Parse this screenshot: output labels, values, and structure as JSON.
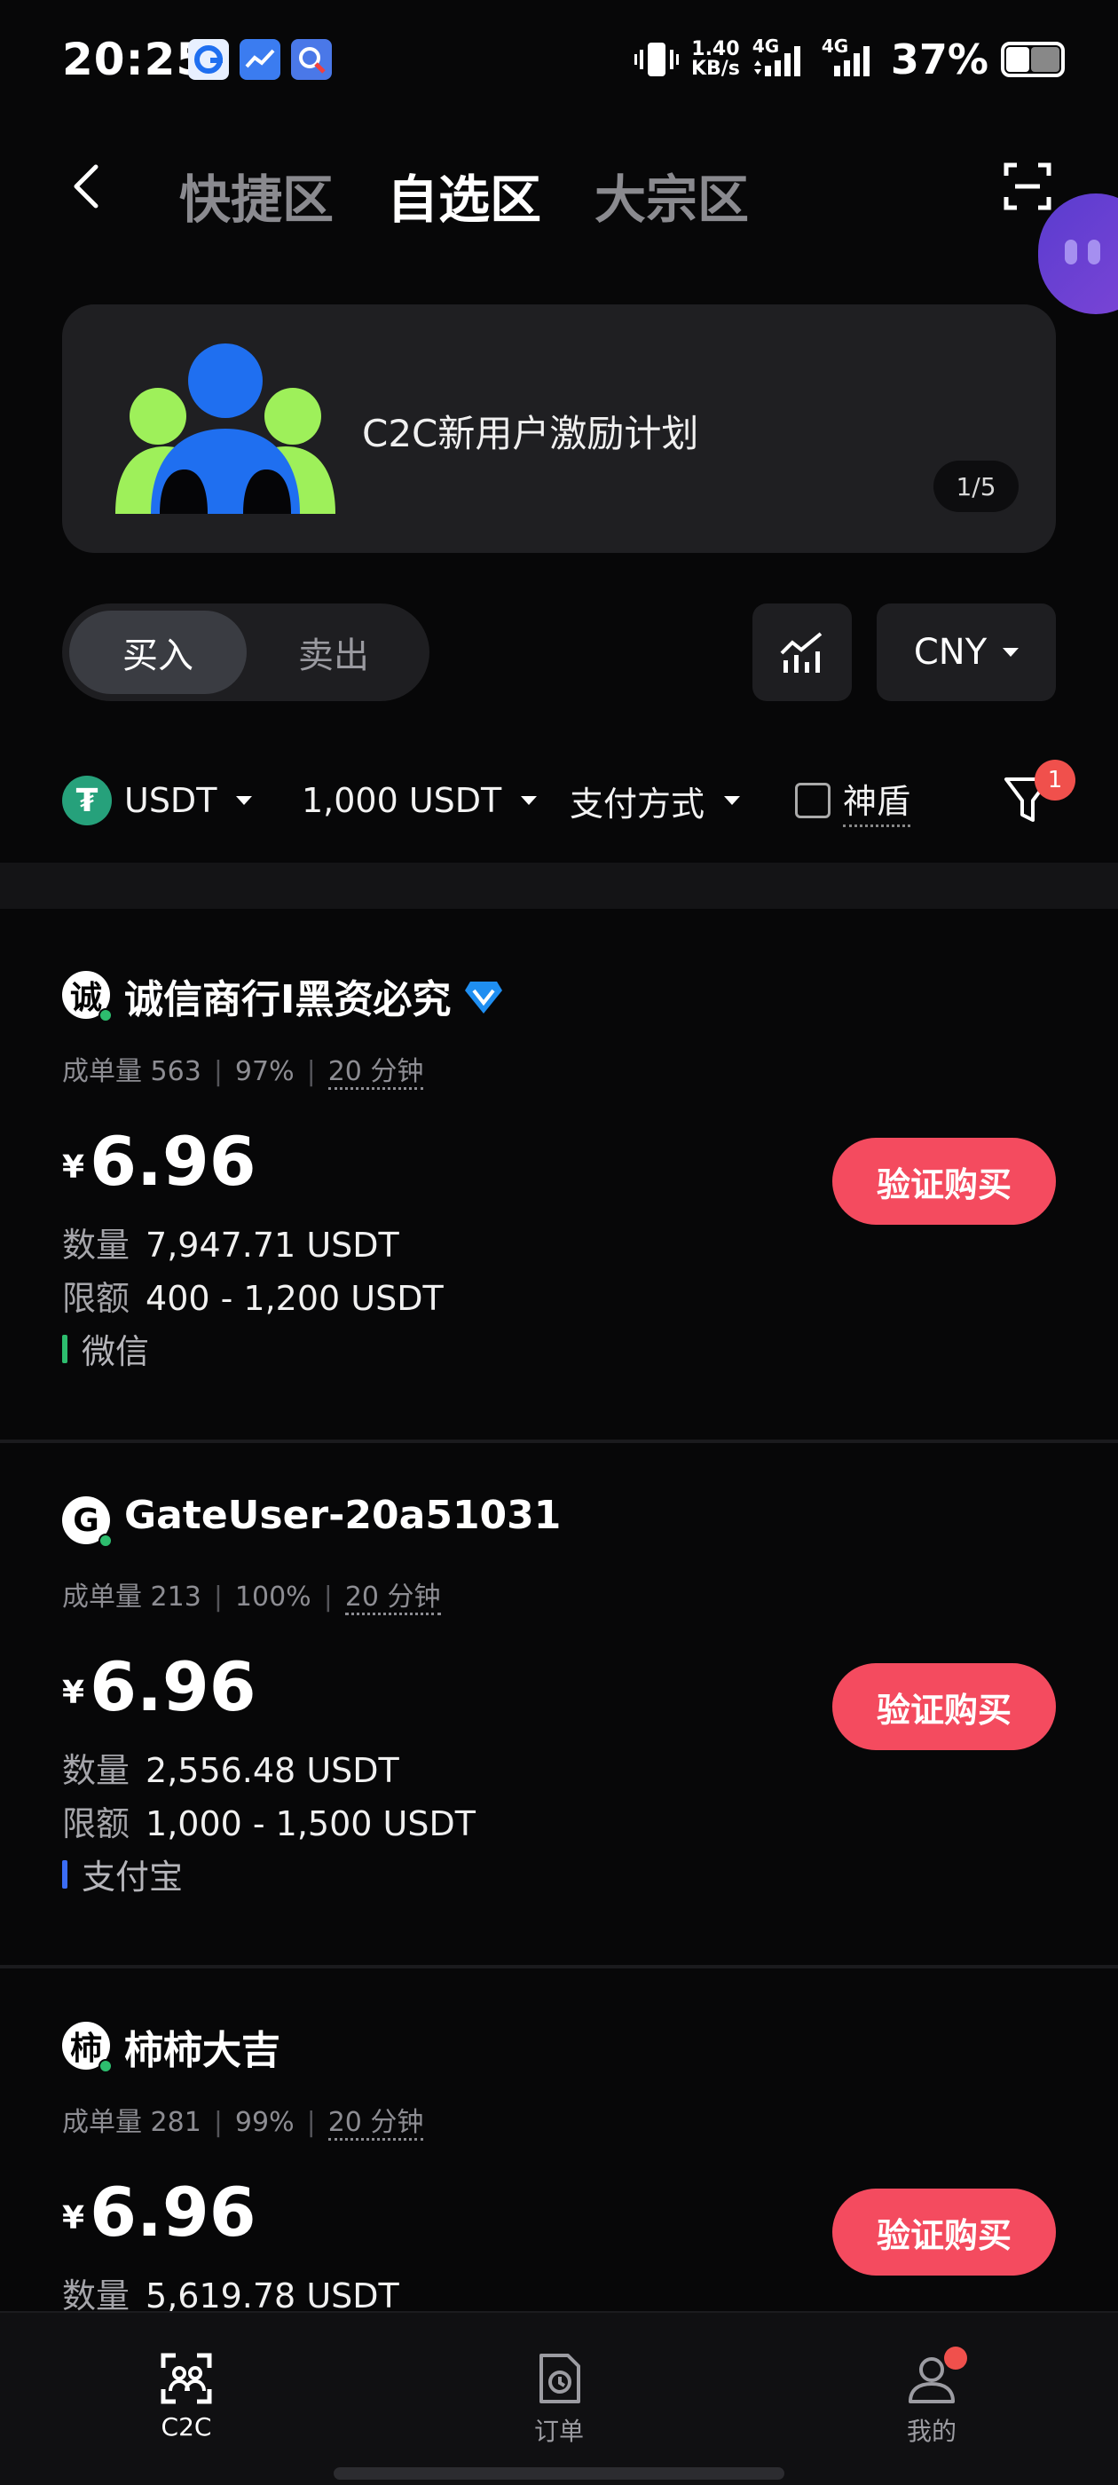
{
  "status_bar": {
    "time": "20:25",
    "speed_value": "1.40",
    "speed_unit": "KB/s",
    "network_1": "4G",
    "network_2": "4G",
    "battery": "37%"
  },
  "header": {
    "tabs": [
      {
        "label": "快捷区",
        "active": false
      },
      {
        "label": "自选区",
        "active": true
      },
      {
        "label": "大宗区",
        "active": false
      }
    ]
  },
  "banner": {
    "text": "C2C新用户激励计划",
    "page_indicator": "1/5"
  },
  "trade_toggle": {
    "buy": "买入",
    "sell": "卖出"
  },
  "currency": "CNY",
  "filters": {
    "asset": "USDT",
    "amount": "1,000 USDT",
    "payment": "支付方式",
    "shield": "神盾",
    "badge_count": "1"
  },
  "listings": [
    {
      "avatar": "诚",
      "name": "诚信商行I黑资必究",
      "verified": true,
      "orders_label": "成单量",
      "orders": "563",
      "rate": "97%",
      "eta": "20 分钟",
      "currency_symbol": "¥",
      "price": "6.96",
      "button": "验证购买",
      "quantity_label": "数量",
      "quantity": "7,947.71 USDT",
      "limit_label": "限额",
      "limit": "400 - 1,200 USDT",
      "payment": "微信",
      "payment_color": "#2dbd6e"
    },
    {
      "avatar": "G",
      "name": "GateUser-20a51031",
      "verified": false,
      "orders_label": "成单量",
      "orders": "213",
      "rate": "100%",
      "eta": "20 分钟",
      "currency_symbol": "¥",
      "price": "6.96",
      "button": "验证购买",
      "quantity_label": "数量",
      "quantity": "2,556.48 USDT",
      "limit_label": "限额",
      "limit": "1,000 - 1,500 USDT",
      "payment": "支付宝",
      "payment_color": "#3b6cf6"
    },
    {
      "avatar": "柿",
      "name": "柿柿大吉",
      "verified": false,
      "orders_label": "成单量",
      "orders": "281",
      "rate": "99%",
      "eta": "20 分钟",
      "currency_symbol": "¥",
      "price": "6.96",
      "button": "验证购买",
      "quantity_label": "数量",
      "quantity": "5,619.78 USDT"
    }
  ],
  "bottom_nav": {
    "items": [
      {
        "label": "C2C",
        "icon": "c2c-icon",
        "active": true
      },
      {
        "label": "订单",
        "icon": "order-icon",
        "active": false
      },
      {
        "label": "我的",
        "icon": "profile-icon",
        "active": false,
        "dot": true
      }
    ]
  },
  "colors": {
    "background": "#070708",
    "accent_buy": "#f44b5f",
    "usdt_green": "#26a17b",
    "badge_red": "#f0504c"
  }
}
